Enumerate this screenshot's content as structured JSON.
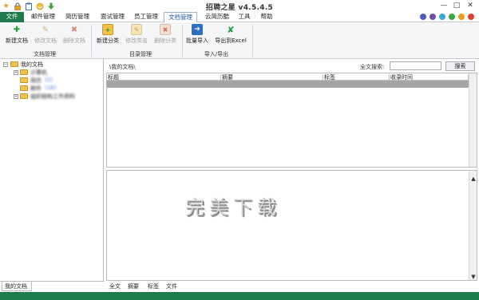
{
  "app": {
    "title": "招聘之星 v4.5.4.5"
  },
  "quick_access": [
    "star-icon",
    "lock-icon",
    "clipboard-icon",
    "refresh-icon",
    "download-icon"
  ],
  "window": {
    "minimize": "—",
    "maximize": "□",
    "close": "✕"
  },
  "menu": {
    "file": "文件",
    "items": [
      "邮件管理",
      "简历管理",
      "面试管理",
      "员工管理",
      "文档管理",
      "云简历酷",
      "工具",
      "帮助"
    ],
    "active": "文档管理"
  },
  "theme_dots": [
    "#4b5db8",
    "#6a4fb0",
    "#3aa8d8",
    "#38a848",
    "#e8a020",
    "#d84030"
  ],
  "ribbon": {
    "groups": [
      {
        "label": "文档管理",
        "buttons": [
          {
            "label": "新建文档",
            "enabled": true
          },
          {
            "label": "修改文档",
            "enabled": false
          },
          {
            "label": "删除文档",
            "enabled": false
          }
        ]
      },
      {
        "label": "目录管理",
        "buttons": [
          {
            "label": "新建分类",
            "enabled": true
          },
          {
            "label": "修改类名",
            "enabled": false
          },
          {
            "label": "删除分类",
            "enabled": false
          }
        ]
      },
      {
        "label": "导入/导出",
        "buttons": [
          {
            "label": "批量导入",
            "enabled": true
          },
          {
            "label": "导出到Excel",
            "enabled": true
          }
        ]
      }
    ]
  },
  "tree": {
    "root": "我的文档",
    "children": [
      "计算机",
      "简历",
      "邮件",
      "组织结构工作资料"
    ]
  },
  "left_tab": "我的文档",
  "path": "\\我的文档\\",
  "search": {
    "label": "全文搜索:",
    "value": "",
    "button": "搜索"
  },
  "grid": {
    "columns": [
      "标题",
      "摘要",
      "标签",
      "收录时间"
    ]
  },
  "preview": {
    "watermark": "完美下载"
  },
  "bottom_tabs": [
    "全文",
    "摘要",
    "标签",
    "文件"
  ]
}
